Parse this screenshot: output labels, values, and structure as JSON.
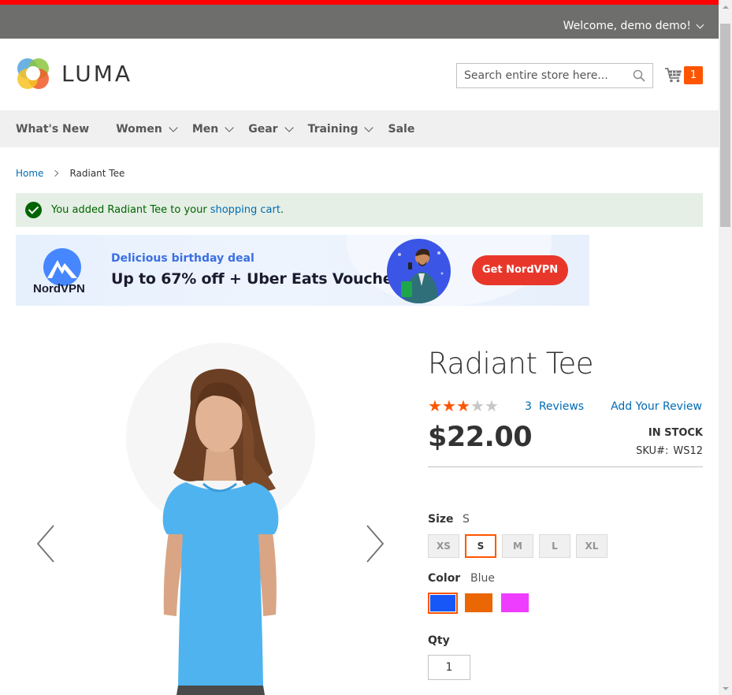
{
  "header": {
    "welcome": "Welcome, demo demo!"
  },
  "logo": {
    "text": "LUMA"
  },
  "search": {
    "placeholder": "Search entire store here..."
  },
  "cart": {
    "count": "1"
  },
  "nav": {
    "items": [
      {
        "label": "What's New",
        "dropdown": false
      },
      {
        "label": "Women",
        "dropdown": true
      },
      {
        "label": "Men",
        "dropdown": true
      },
      {
        "label": "Gear",
        "dropdown": true
      },
      {
        "label": "Training",
        "dropdown": true
      },
      {
        "label": "Sale",
        "dropdown": false
      }
    ]
  },
  "breadcrumb": {
    "home": "Home",
    "current": "Radiant Tee"
  },
  "message": {
    "text": "You added Radiant Tee to your",
    "link": "shopping cart",
    "suffix": "."
  },
  "ad": {
    "brand": "NordVPN",
    "eyebrow": "Delicious birthday deal",
    "headline": "Up to 67% off + Uber Eats Voucher",
    "cta": "Get NordVPN"
  },
  "product": {
    "title": "Radiant Tee",
    "rating": 3,
    "rating_max": 5,
    "reviews_count": "3",
    "reviews_label": "Reviews",
    "add_review": "Add Your Review",
    "price": "$22.00",
    "stock": "IN STOCK",
    "sku_label": "SKU#:",
    "sku": "WS12",
    "size_label": "Size",
    "size_selected": "S",
    "sizes": [
      "XS",
      "S",
      "M",
      "L",
      "XL"
    ],
    "color_label": "Color",
    "color_selected": "Blue",
    "colors": [
      {
        "name": "Blue",
        "hex": "#1857f7"
      },
      {
        "name": "Orange",
        "hex": "#eb6703"
      },
      {
        "name": "Purple",
        "hex": "#ef3dff"
      }
    ],
    "qty_label": "Qty",
    "qty": "1"
  },
  "colors": {
    "accent": "#ff5501",
    "link": "#006bb4",
    "header_bg": "#6e6e6c",
    "top_strip": "#ff0000"
  }
}
